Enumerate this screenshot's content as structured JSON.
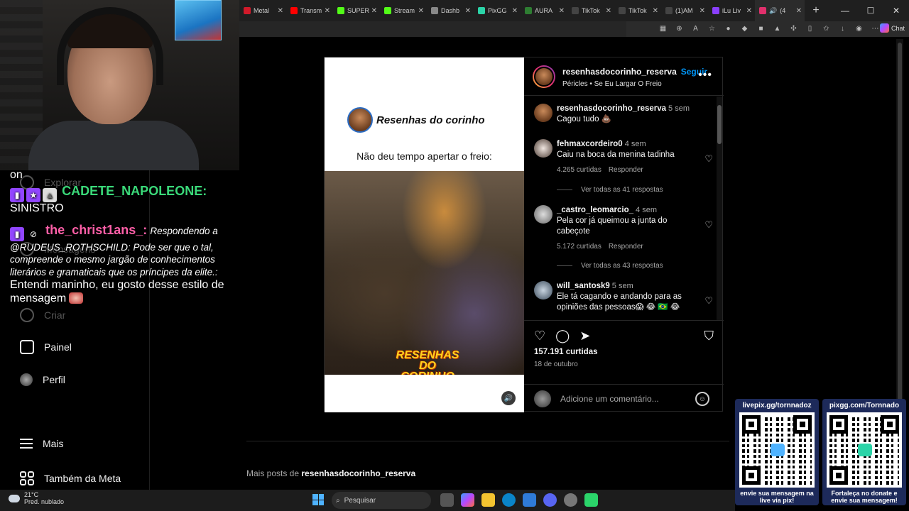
{
  "browser": {
    "tabs": [
      {
        "title": "Metal",
        "color": "#d11a2a"
      },
      {
        "title": "Transm",
        "color": "#ff0000"
      },
      {
        "title": "SUPER",
        "color": "#53fc18"
      },
      {
        "title": "Stream",
        "color": "#53fc18"
      },
      {
        "title": "Dashb",
        "color": "#888888"
      },
      {
        "title": "PixGG",
        "color": "#2bd4a8"
      },
      {
        "title": "AURA",
        "color": "#2e7d32"
      },
      {
        "title": "TikTok",
        "color": "#222222"
      },
      {
        "title": "TikTok",
        "color": "#222222"
      },
      {
        "title": "(1)AM",
        "color": "#222222"
      },
      {
        "title": "iLu Liv",
        "color": "#8a3ffc"
      },
      {
        "title": "(4",
        "color": "#e1306c"
      }
    ],
    "chat_label": "Chat"
  },
  "stream_overlay": {
    "instagram_nav": {
      "explore": "Explorar",
      "messages": "Mensagens",
      "create": "Criar",
      "dashboard": "Painel",
      "profile": "Perfil",
      "more": "Mais",
      "meta": "Também da Meta"
    },
    "chat": {
      "fragment": "on",
      "msg1_user": "CADETE_NAPOLEONE:",
      "msg1_text": "SINISTRO",
      "msg2_user": "the_christ1ans_:",
      "msg2_reply": "Respondendo a @RUDEUS_ROTHSCHILD: Pode ser que o tal, compreende o mesmo jargão de conhecimentos literários e gramaticais que os príncipes da elite.:",
      "msg2_text": "Entendi maninho, eu gosto desse estilo de mensagem"
    }
  },
  "post": {
    "media": {
      "brand_name": "Resenhas do corinho",
      "caption": "Não deu tempo apertar o freio:",
      "watermark": "RESENHAS DO CORINHO"
    },
    "author": {
      "username": "resenhasdocorinho_reserva",
      "follow_label": "Seguir",
      "song": "Péricles • Se Eu Largar O Freio"
    },
    "comments": [
      {
        "user": "resenhasdocorinho_reserva",
        "time": "5 sem",
        "text": "Cagou tudo 💩",
        "color": "#8a5a35"
      },
      {
        "user": "fehmaxcordeiro0",
        "time": "4 sem",
        "text": "Caiu na boca da menina tadinha",
        "likes": "4.265 curtidas",
        "reply": "Responder",
        "view_replies": "Ver todas as 41 respostas",
        "color": "#d8cfc8"
      },
      {
        "user": "_castro_leomarcio_",
        "time": "4 sem",
        "text": "Pela cor já queimou a junta do cabeçote",
        "likes": "5.172 curtidas",
        "reply": "Responder",
        "view_replies": "Ver todas as 43 respostas",
        "color": "#aaaaaa"
      },
      {
        "user": "will_santosk9",
        "time": "5 sem",
        "text": "Ele tá cagando e andando para as opiniões das pessoas😱 😂 🇧🇷 😂",
        "color": "#7a8ba0"
      }
    ],
    "likes": "157.191 curtidas",
    "date": "18 de outubro",
    "comment_placeholder": "Adicione um comentário..."
  },
  "more_posts": {
    "prefix": "Mais posts de",
    "user": "resenhasdocorinho_reserva"
  },
  "qr": {
    "left_header": "livepix.gg/tornnadoz",
    "left_footer": "envie sua mensagem na live via pix!",
    "left_center_color": "#4fb3ff",
    "right_header": "pixgg.com/Tornnado",
    "right_footer": "Fortaleça no donate e envie sua mensagem!",
    "right_center_color": "#2bd4a8"
  },
  "taskbar": {
    "temperature": "21°C",
    "weather": "Pred. nublado",
    "search": "Pesquisar"
  }
}
